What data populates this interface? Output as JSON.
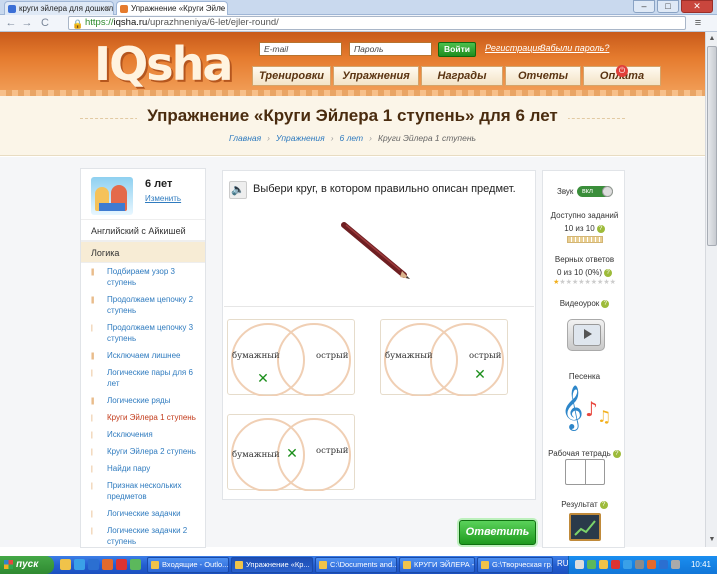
{
  "browser": {
    "tabs": [
      {
        "title": "круги эйлера для дошкол",
        "close": "×"
      },
      {
        "title": "Упражнение «Круги Эйле",
        "close": "×"
      }
    ],
    "url": {
      "scheme": "https://",
      "host": "iqsha.ru",
      "path": "/uprazhneniya/6-let/ejler-round/"
    },
    "nav": {
      "back": "←",
      "forward": "→",
      "reload": "C",
      "wrench": "≡"
    },
    "window_buttons": {
      "min": "–",
      "max": "□",
      "close": "✕"
    }
  },
  "header": {
    "logo": "IQsha",
    "email_placeholder": "E-mail",
    "password_placeholder": "Пароль",
    "login_button": "Войти",
    "register_link": "Регистрация",
    "forgot_link": "Забыли пароль?",
    "nav": [
      "Тренировки",
      "Упражнения",
      "Награды",
      "Отчеты",
      "Оплата"
    ]
  },
  "page": {
    "title": "Упражнение «Круги Эйлера 1 ступень» для 6 лет",
    "breadcrumb": [
      "Главная",
      "Упражнения",
      "6 лет",
      "Круги Эйлера 1 ступень"
    ]
  },
  "sidebar": {
    "age": "6 лет",
    "change": "Изменить",
    "sections": [
      "Английский с Айкишей",
      "Логика"
    ],
    "items": [
      {
        "label": "Подбираем узор 3 ступень",
        "bars": "|||"
      },
      {
        "label": "Продолжаем цепочку 2 ступень",
        "bars": "|||"
      },
      {
        "label": "Продолжаем цепочку 3 ступень",
        "bars": "|"
      },
      {
        "label": "Исключаем лишнее",
        "bars": "|||"
      },
      {
        "label": "Логические пары для 6 лет",
        "bars": "|"
      },
      {
        "label": "Логические ряды",
        "bars": "|||"
      },
      {
        "label": "Круги Эйлера 1 ступень",
        "bars": "|"
      },
      {
        "label": "Исключения",
        "bars": "|"
      },
      {
        "label": "Круги Эйлера 2 ступень",
        "bars": "|"
      },
      {
        "label": "Найди пару",
        "bars": "|"
      },
      {
        "label": "Признак нескольких предметов",
        "bars": "|"
      },
      {
        "label": "Логические задачки",
        "bars": "|"
      },
      {
        "label": "Логические задачки 2 ступень",
        "bars": "|"
      }
    ]
  },
  "exercise": {
    "instruction": "Выбери круг, в котором правильно описан предмет.",
    "answers": [
      {
        "left": "бумажный",
        "right": "острый"
      },
      {
        "left": "бумажный",
        "right": "острый"
      },
      {
        "left": "бумажный",
        "right": "острый"
      }
    ],
    "mark": "✕",
    "submit": "Ответить"
  },
  "right_panel": {
    "sound_label": "Звук",
    "sound_state": "вкл",
    "available_label": "Доступно заданий",
    "available_value": "10 из 10",
    "correct_label": "Верных ответов",
    "correct_value": "0 из 10 (0%)",
    "video_label": "Видеоурок",
    "song_label": "Песенка",
    "workbook_label": "Рабочая тетрадь",
    "result_label": "Результат",
    "help": "?"
  },
  "taskbar": {
    "start": "пуск",
    "items": [
      "Входящие - Outlo...",
      "Упражнение «Кр...",
      "C:\\Documents and...",
      "КРУГИ ЭЙЛЕРА - ...",
      "G:\\Творческая гр..."
    ],
    "lang": "RU",
    "time": "10:41"
  },
  "colors": {
    "header_orange": "#e57b2e",
    "link_blue": "#2f7bbf",
    "current_red": "#c23a1a",
    "green_button": "#1e9a1e",
    "circle_stroke": "#f0cfb4",
    "mark_green": "#1c8f1c"
  }
}
